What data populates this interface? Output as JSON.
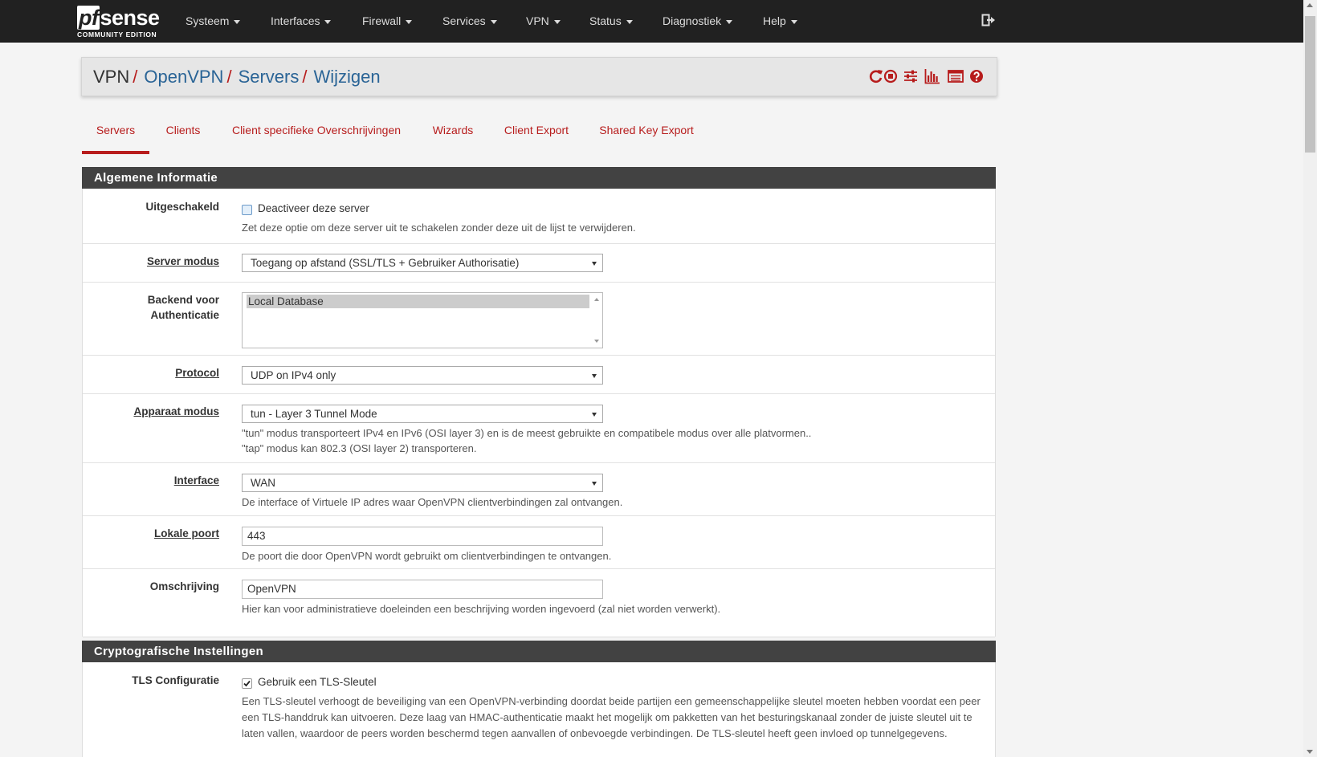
{
  "brand": {
    "name_pf": "pf",
    "name_rest": "sense",
    "edition": "COMMUNITY EDITION"
  },
  "nav": [
    {
      "label": "Systeem"
    },
    {
      "label": "Interfaces"
    },
    {
      "label": "Firewall"
    },
    {
      "label": "Services"
    },
    {
      "label": "VPN"
    },
    {
      "label": "Status"
    },
    {
      "label": "Diagnostiek"
    },
    {
      "label": "Help"
    }
  ],
  "breadcrumb": [
    "VPN",
    "OpenVPN",
    "Servers",
    "Wijzigen"
  ],
  "breadcrumb_sep": "/",
  "tabs": [
    "Servers",
    "Clients",
    "Client specifieke Overschrijvingen",
    "Wizards",
    "Client Export",
    "Shared Key Export"
  ],
  "colors": {
    "accent": "#b71c1c",
    "navbar": "#212121",
    "heading": "#424242",
    "link": "#2a6496"
  },
  "sections": {
    "general": {
      "title": "Algemene Informatie",
      "disabled": {
        "label": "Uitgeschakeld",
        "checkbox_label": "Deactiveer deze server",
        "checked": false,
        "help": "Zet deze optie om deze server uit te schakelen zonder deze uit de lijst te verwijderen."
      },
      "server_mode": {
        "label": "Server modus",
        "value": "Toegang op afstand (SSL/TLS + Gebruiker Authorisatie)"
      },
      "auth_backend": {
        "label_line1": "Backend voor",
        "label_line2": "Authenticatie",
        "options": [
          "Local Database"
        ]
      },
      "protocol": {
        "label": "Protocol",
        "value": "UDP on IPv4 only"
      },
      "device_mode": {
        "label": "Apparaat modus",
        "value": "tun - Layer 3 Tunnel Mode",
        "help_line1": "\"tun\" modus transporteert IPv4 en IPv6 (OSI layer 3) en is de meest gebruikte en compatibele modus over alle platvormen..",
        "help_line2": "\"tap\" modus kan 802.3 (OSI layer 2) transporteren."
      },
      "interface": {
        "label": "Interface",
        "value": "WAN",
        "help": "De interface of Virtuele IP adres waar OpenVPN clientverbindingen zal ontvangen."
      },
      "local_port": {
        "label": "Lokale poort",
        "value": "443",
        "help": "De poort die door OpenVPN wordt gebruikt om clientverbindingen te ontvangen."
      },
      "description": {
        "label": "Omschrijving",
        "value": "OpenVPN",
        "help": "Hier kan voor administratieve doeleinden een beschrijving worden ingevoerd (zal niet worden verwerkt)."
      }
    },
    "crypto": {
      "title": "Cryptografische Instellingen",
      "tls": {
        "label": "TLS Configuratie",
        "checkbox_label": "Gebruik een TLS-Sleutel",
        "checked": true,
        "help": "Een TLS-sleutel verhoogt de beveiliging van een OpenVPN-verbinding doordat beide partijen een gemeenschappelijke sleutel moeten hebben voordat een peer een TLS-handdruk kan uitvoeren. Deze laag van HMAC-authenticatie maakt het mogelijk om pakketten van het besturingskanaal zonder de juiste sleutel uit te laten vallen, waardoor de peers worden beschermd tegen aanvallen of onbevoegde verbindingen. De TLS-sleutel heeft geen invloed op tunnelgegevens."
      }
    }
  }
}
